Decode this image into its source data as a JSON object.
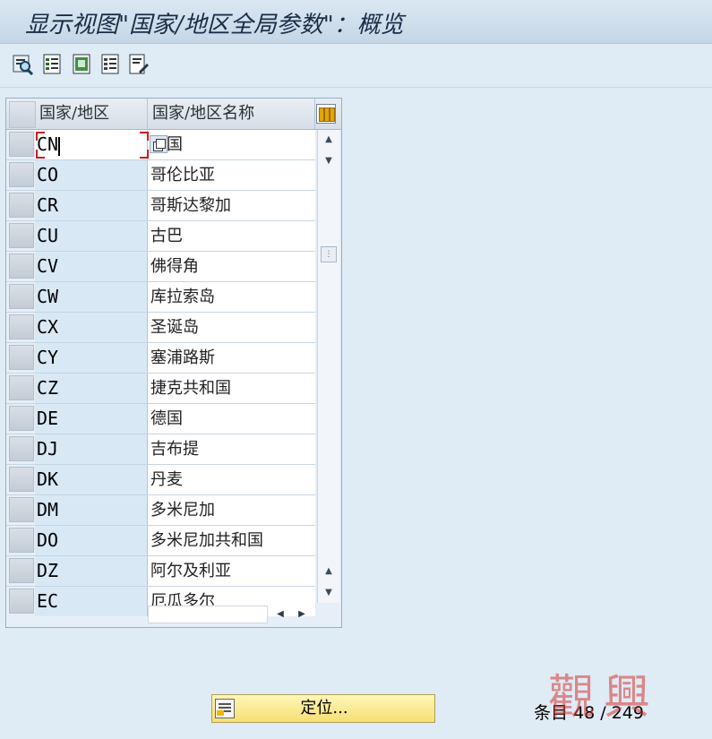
{
  "window": {
    "title": "显示视图\"国家/地区全局参数\"：概览"
  },
  "toolbar": {
    "buttons": [
      {
        "name": "details-icon"
      },
      {
        "name": "select-all-icon"
      },
      {
        "name": "select-block-icon"
      },
      {
        "name": "deselect-all-icon"
      },
      {
        "name": "print-icon"
      }
    ]
  },
  "table": {
    "columns": [
      "国家/地区",
      "国家/地区名称"
    ],
    "rows": [
      {
        "code": "CN",
        "name": "国"
      },
      {
        "code": "CO",
        "name": "哥伦比亚"
      },
      {
        "code": "CR",
        "name": "哥斯达黎加"
      },
      {
        "code": "CU",
        "name": "古巴"
      },
      {
        "code": "CV",
        "name": "佛得角"
      },
      {
        "code": "CW",
        "name": "库拉索岛"
      },
      {
        "code": "CX",
        "name": "圣诞岛"
      },
      {
        "code": "CY",
        "name": "塞浦路斯"
      },
      {
        "code": "CZ",
        "name": "捷克共和国"
      },
      {
        "code": "DE",
        "name": "德国"
      },
      {
        "code": "DJ",
        "name": "吉布提"
      },
      {
        "code": "DK",
        "name": "丹麦"
      },
      {
        "code": "DM",
        "name": "多米尼加"
      },
      {
        "code": "DO",
        "name": "多米尼加共和国"
      },
      {
        "code": "DZ",
        "name": "阿尔及利亚"
      },
      {
        "code": "EC",
        "name": "厄瓜多尔"
      }
    ]
  },
  "footer": {
    "position_label": "定位...",
    "entry_label": "条目",
    "entry_count": "48 / 249"
  },
  "watermark": {
    "text": "觀興"
  },
  "colors": {
    "focus": "#c4201d",
    "button": "#f6df73"
  }
}
